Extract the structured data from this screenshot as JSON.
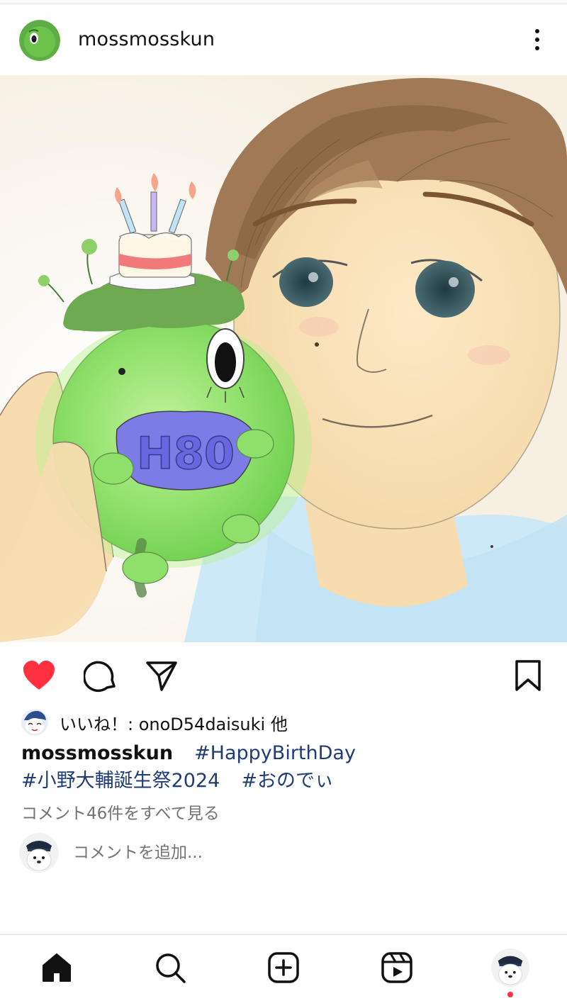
{
  "post": {
    "username": "mossmosskun",
    "more_label": "more options",
    "image_alt": "Illustration of a brown-haired man holding a green moss mascot wearing a birthday cake hat"
  },
  "actions": {
    "like": "like-icon",
    "comment": "comment-icon",
    "share": "share-icon",
    "save": "bookmark-icon",
    "liked": true,
    "like_color": "#ff3040"
  },
  "likes": {
    "prefix": "いいね！: ",
    "user": "onoD54daisuki",
    "suffix": " 他"
  },
  "caption": {
    "username": "mossmosskun",
    "tags": [
      "#HappyBirthDay",
      "#小野大輔誕生祭2024",
      "#おのでぃ"
    ]
  },
  "comments": {
    "view_all": "コメント46件をすべて見る",
    "add_placeholder": "コメントを追加..."
  },
  "nav": {
    "home": "home-icon",
    "search": "search-icon",
    "create": "create-icon",
    "reels": "reels-icon",
    "profile": "profile-avatar"
  },
  "colors": {
    "hashtag": "#1f3d74",
    "secondary_text": "#737373",
    "notification_dot": "#ff3040"
  }
}
